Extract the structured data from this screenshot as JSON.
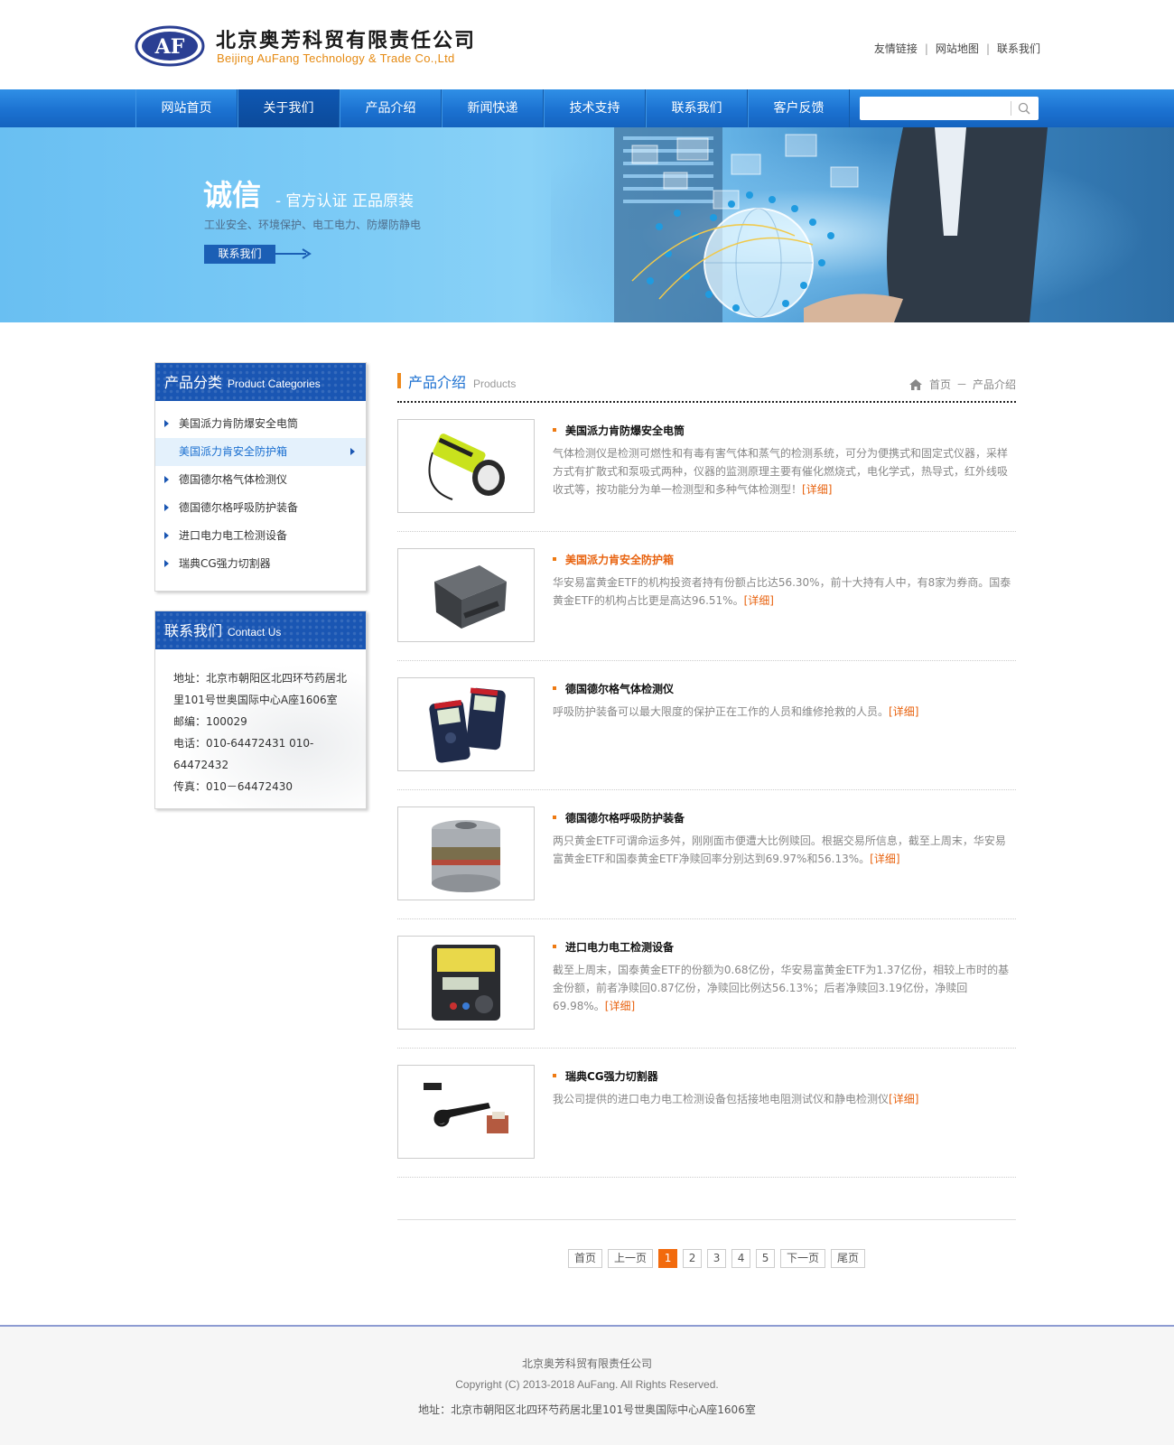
{
  "header": {
    "logo_text": "AF",
    "company_cn": "北京奥芳科贸有限责任公司",
    "company_en": "Beijing AuFang Technology & Trade Co.,Ltd",
    "top_links": [
      "友情链接",
      "网站地图",
      "联系我们"
    ]
  },
  "nav": {
    "items": [
      "网站首页",
      "关于我们",
      "产品介绍",
      "新闻快递",
      "技术支持",
      "联系我们",
      "客户反馈"
    ],
    "active": "关于我们",
    "search_placeholder": ""
  },
  "banner": {
    "title": "诚信",
    "subtitle": "- 官方认证 正品原装",
    "desc": "工业安全、环境保护、电工电力、防爆防静电",
    "button": "联系我们"
  },
  "sidebar": {
    "categories_title_cn": "产品分类",
    "categories_title_en": "Product Categories",
    "categories": [
      "美国派力肯防爆安全电筒",
      "美国派力肯安全防护箱",
      "德国德尔格气体检测仪",
      "德国德尔格呼吸防护装备",
      "进口电力电工检测设备",
      "瑞典CG强力切割器"
    ],
    "active_category": "美国派力肯安全防护箱",
    "contact_title_cn": "联系我们",
    "contact_title_en": "Contact Us",
    "contact": {
      "address_1": "地址：北京市朝阳区北四环芍药居北",
      "address_2": "里101号世奥国际中心A座1606室",
      "postcode": "邮编：100029",
      "phone": "电话：010-64472431 010-64472432",
      "fax": "传真：010－64472430"
    }
  },
  "main": {
    "title": "产品介绍",
    "title_en": "Products",
    "breadcrumb": [
      "首页",
      "产品介绍"
    ],
    "more_label": "[详细]",
    "products": [
      {
        "name": "美国派力肯防爆安全电筒",
        "name_color": "#111111",
        "desc": "气体检测仪是检测可燃性和有毒有害气体和蒸气的检测系统，可分为便携式和固定式仪器，采样方式有扩散式和泵吸式两种，仪器的监测原理主要有催化燃烧式，电化学式，热导式，红外线吸收式等，按功能分为单一检测型和多种气体检测型！",
        "image": "flashlight"
      },
      {
        "name": "美国派力肯安全防护箱",
        "name_color": "#e8620e",
        "desc": "华安易富黄金ETF的机构投资者持有份额占比达56.30%，前十大持有人中，有8家为券商。国泰黄金ETF的机构占比更是高达96.51%。",
        "image": "case"
      },
      {
        "name": "德国德尔格气体检测仪",
        "name_color": "#111111",
        "desc": "呼吸防护装备可以最大限度的保护正在工作的人员和维修抢救的人员。",
        "image": "detector"
      },
      {
        "name": "德国德尔格呼吸防护装备",
        "name_color": "#111111",
        "desc": "两只黄金ETF可谓命运多舛，刚刚面市便遭大比例赎回。根据交易所信息，截至上周末，华安易富黄金ETF和国泰黄金ETF净赎回率分别达到69.97%和56.13%。",
        "image": "filter"
      },
      {
        "name": "进口电力电工检测设备",
        "name_color": "#111111",
        "desc": "截至上周末，国泰黄金ETF的份额为0.68亿份，华安易富黄金ETF为1.37亿份，相较上市时的基金份额，前者净赎回0.87亿份，净赎回比例达56.13%；后者净赎回3.19亿份，净赎回69.98%。",
        "image": "meter"
      },
      {
        "name": "瑞典CG强力切割器",
        "name_color": "#111111",
        "desc": "我公司提供的进口电力电工检测设备包括接地电阻测试仪和静电检测仪",
        "image": "cutter"
      }
    ]
  },
  "pager": {
    "first": "首页",
    "prev": "上一页",
    "pages": [
      "1",
      "2",
      "3",
      "4",
      "5"
    ],
    "current": "1",
    "next": "下一页",
    "last": "尾页"
  },
  "footer": {
    "company": "北京奥芳科贸有限责任公司",
    "copyright": "Copyright (C) 2013-2018 AuFang. All Rights Reserved.",
    "address": "地址：北京市朝阳区北四环芍药居北里101号世奥国际中心A座1606室"
  },
  "colors": {
    "nav_blue": "#1c72d1",
    "accent_orange": "#e8620e",
    "title_blue": "#1a6fd0",
    "sidebar_blue": "#1a56b3"
  },
  "icons": [
    "logo-mark",
    "search-icon",
    "arrow-right-icon",
    "home-icon",
    "triangle-right-icon"
  ]
}
